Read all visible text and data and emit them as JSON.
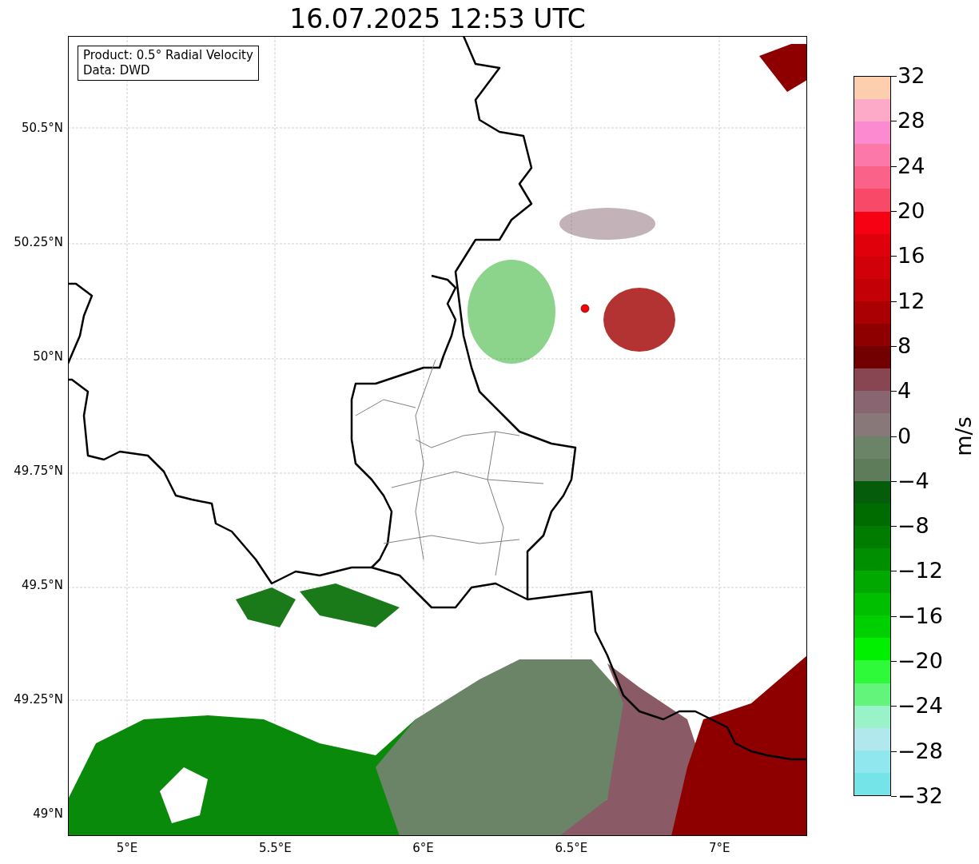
{
  "title": "16.07.2025 12:53 UTC",
  "info_box": {
    "lines": [
      "Product: 0.5° Radial Velocity",
      "Data: DWD"
    ]
  },
  "map": {
    "lat_ticks": [
      "50.5°N",
      "50.25°N",
      "50°N",
      "49.75°N",
      "49.5°N",
      "49.25°N",
      "49°N"
    ],
    "lon_ticks": [
      "5°E",
      "5.5°E",
      "6°E",
      "6.5°E",
      "7°E"
    ]
  },
  "colorbar": {
    "label": "m/s",
    "ticks": [
      "32",
      "28",
      "24",
      "20",
      "16",
      "12",
      "8",
      "4",
      "0",
      "−4",
      "−8",
      "−12",
      "−16",
      "−20",
      "−24",
      "−28",
      "−32"
    ],
    "segments": [
      {
        "color": "#fecfae"
      },
      {
        "color": "#fda9c8"
      },
      {
        "color": "#fb8ad0"
      },
      {
        "color": "#fb78a8"
      },
      {
        "color": "#fa6289"
      },
      {
        "color": "#f84a68"
      },
      {
        "color": "#f60014"
      },
      {
        "color": "#e0000c"
      },
      {
        "color": "#d20008"
      },
      {
        "color": "#c20006"
      },
      {
        "color": "#ab0003"
      },
      {
        "color": "#8e0000"
      },
      {
        "color": "#720000"
      },
      {
        "color": "#874651"
      },
      {
        "color": "#886570"
      },
      {
        "color": "#88787a"
      },
      {
        "color": "#6b8468"
      },
      {
        "color": "#5e7c59"
      },
      {
        "color": "#055d0b"
      },
      {
        "color": "#006c00"
      },
      {
        "color": "#007c00"
      },
      {
        "color": "#008f00"
      },
      {
        "color": "#00a800"
      },
      {
        "color": "#00be00"
      },
      {
        "color": "#00d000"
      },
      {
        "color": "#00f000"
      },
      {
        "color": "#2ffa3a"
      },
      {
        "color": "#63f47c"
      },
      {
        "color": "#9af3c8"
      },
      {
        "color": "#b0e8ee"
      },
      {
        "color": "#90e8ee"
      },
      {
        "color": "#74e4e8"
      }
    ]
  }
}
